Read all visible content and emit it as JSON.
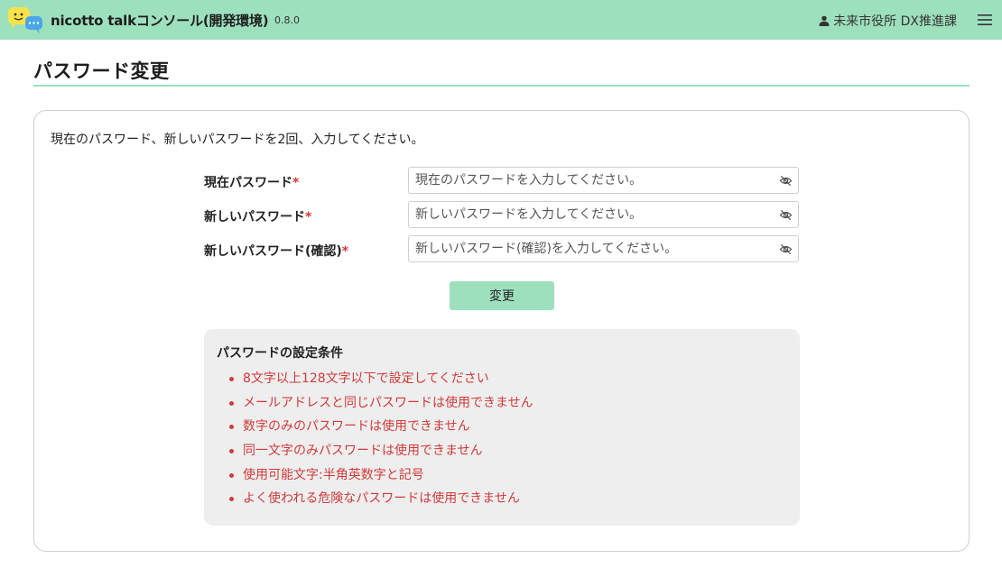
{
  "header": {
    "app_title": "nicotto talkコンソール(開発環境)",
    "version": "0.8.0",
    "user_name": "未来市役所 DX推進課",
    "accent_color": "#9de0bd"
  },
  "page": {
    "title": "パスワード変更",
    "instruction": "現在のパスワード、新しいパスワードを2回、入力してください。"
  },
  "form": {
    "fields": [
      {
        "label": "現在パスワード",
        "required_mark": "*",
        "placeholder": "現在のパスワードを入力してください。",
        "value": "",
        "icon": "eye-slash-icon"
      },
      {
        "label": "新しいパスワード",
        "required_mark": "*",
        "placeholder": "新しいパスワードを入力してください。",
        "value": "",
        "icon": "eye-slash-icon"
      },
      {
        "label": "新しいパスワード(確認)",
        "required_mark": "*",
        "placeholder": "新しいパスワード(確認)を入力してください。",
        "value": "",
        "icon": "eye-slash-icon"
      }
    ],
    "submit_label": "変更"
  },
  "conditions": {
    "title": "パスワードの設定条件",
    "items": [
      "8文字以上128文字以下で設定してください",
      "メールアドレスと同じパスワードは使用できません",
      "数字のみのパスワードは使用できません",
      "同一文字のみパスワードは使用できません",
      "使用可能文字:半角英数字と記号",
      "よく使われる危険なパスワードは使用できません"
    ],
    "text_color": "#d13a3a"
  }
}
